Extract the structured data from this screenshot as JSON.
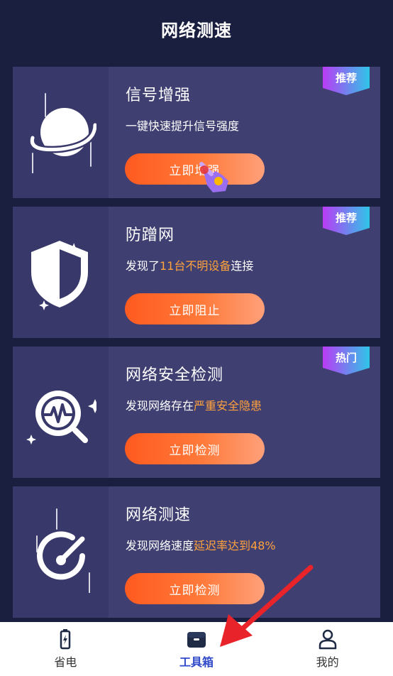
{
  "header": {
    "title": "网络测速"
  },
  "cards": [
    {
      "name": "信号增强",
      "desc_plain": "一键快速提升信号强度",
      "button": "立即增强",
      "badge": "推荐",
      "icon": "planet-icon"
    },
    {
      "name": "防蹭网",
      "desc_pre": "发现了",
      "desc_highlight": "11台不明设备",
      "desc_post": "连接",
      "button": "立即阻止",
      "badge": "推荐",
      "icon": "shield-icon"
    },
    {
      "name": "网络安全检测",
      "desc_pre": "发现网络存在",
      "desc_highlight": "严重安全隐患",
      "button": "立即检测",
      "badge": "热门",
      "icon": "magnifier-pulse-icon"
    },
    {
      "name": "网络测速",
      "desc_pre": "发现网络速度",
      "desc_highlight": "延迟率达到48%",
      "button": "立即检测",
      "icon": "speedometer-icon"
    }
  ],
  "tabbar": {
    "items": [
      {
        "label": "省电",
        "icon": "battery-icon"
      },
      {
        "label": "工具箱",
        "icon": "toolbox-icon",
        "active": true
      },
      {
        "label": "我的",
        "icon": "user-icon"
      }
    ]
  },
  "colors": {
    "background": "#1b1f3f",
    "card": "#3f3f72",
    "highlight": "#ffa23c",
    "button": "#ff5a1f",
    "active_tab": "#2f49c8"
  }
}
